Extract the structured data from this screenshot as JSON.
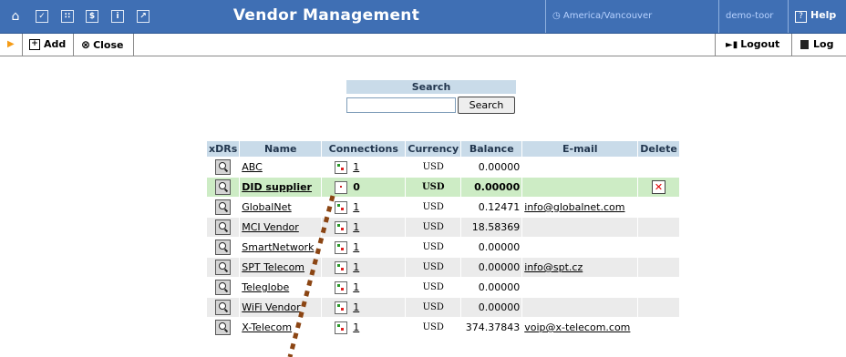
{
  "header": {
    "title": "Vendor Management",
    "timezone": "America/Vancouver",
    "user": "demo-toor",
    "help": "Help",
    "icons": [
      "home-icon",
      "check-icon",
      "grid-icon",
      "dollar-icon",
      "info-icon",
      "chart-icon"
    ]
  },
  "toolbar": {
    "add_label": "Add",
    "close_label": "Close",
    "logout_label": "Logout",
    "log_label": "Log"
  },
  "search": {
    "label": "Search",
    "value": "",
    "button_label": "Search"
  },
  "table": {
    "columns": [
      "xDRs",
      "Name",
      "Connections",
      "Currency",
      "Balance",
      "E-mail",
      "Delete"
    ],
    "rows": [
      {
        "name": "ABC",
        "connections": "1",
        "currency": "USD",
        "balance": "0.00000",
        "email": "",
        "deletable": false,
        "highlight": false
      },
      {
        "name": "DID supplier",
        "connections": "0",
        "currency": "USD",
        "balance": "0.00000",
        "email": "",
        "deletable": true,
        "highlight": true
      },
      {
        "name": "GlobalNet",
        "connections": "1",
        "currency": "USD",
        "balance": "0.12471",
        "email": "info@globalnet.com",
        "deletable": false,
        "highlight": false
      },
      {
        "name": "MCI Vendor",
        "connections": "1",
        "currency": "USD",
        "balance": "18.58369",
        "email": "",
        "deletable": false,
        "highlight": false
      },
      {
        "name": "SmartNetwork",
        "connections": "1",
        "currency": "USD",
        "balance": "0.00000",
        "email": "",
        "deletable": false,
        "highlight": false
      },
      {
        "name": "SPT Telecom",
        "connections": "1",
        "currency": "USD",
        "balance": "0.00000",
        "email": "info@spt.cz",
        "deletable": false,
        "highlight": false
      },
      {
        "name": "Teleglobe",
        "connections": "1",
        "currency": "USD",
        "balance": "0.00000",
        "email": "",
        "deletable": false,
        "highlight": false
      },
      {
        "name": "WiFi Vendor",
        "connections": "1",
        "currency": "USD",
        "balance": "0.00000",
        "email": "",
        "deletable": false,
        "highlight": false
      },
      {
        "name": "X-Telecom",
        "connections": "1",
        "currency": "USD",
        "balance": "374.37843",
        "email": "voip@x-telecom.com",
        "deletable": false,
        "highlight": false
      }
    ]
  },
  "colors": {
    "header_bg": "#3f6fb4",
    "table_header_bg": "#c9dbe9",
    "highlight_row_bg": "#cdecc5",
    "annotation": "#8b4513"
  }
}
